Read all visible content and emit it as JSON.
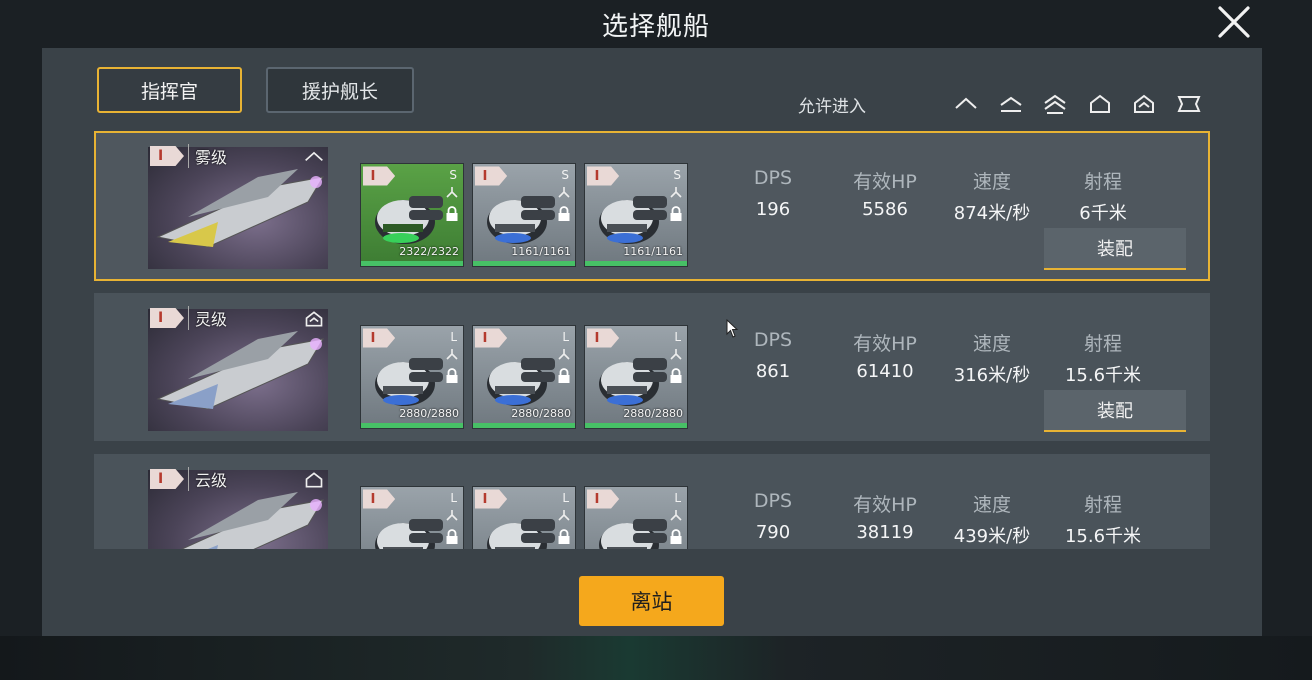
{
  "title": "选择舰船",
  "tabs": [
    {
      "label": "指挥官",
      "active": true
    },
    {
      "label": "援护舰长",
      "active": false
    }
  ],
  "filter": {
    "label": "允许进入",
    "class_icons": [
      "chevron-1-icon",
      "chevron-1-bar-icon",
      "chevron-2-icon",
      "house-icon",
      "house-chevron-icon",
      "banner-icon"
    ]
  },
  "stat_headers": {
    "dps": "DPS",
    "hp": "有效HP",
    "speed": "速度",
    "range": "射程"
  },
  "equip_label": "装配",
  "ships": [
    {
      "tier": "I",
      "name": "雾级",
      "class_icon": "chevron-1-icon",
      "selected": true,
      "weapons": [
        {
          "tier": "I",
          "size": "S",
          "hp": "2322/2322",
          "hp_fraction": 1.0,
          "highlight": true
        },
        {
          "tier": "I",
          "size": "S",
          "hp": "1161/1161",
          "hp_fraction": 1.0,
          "highlight": false
        },
        {
          "tier": "I",
          "size": "S",
          "hp": "1161/1161",
          "hp_fraction": 1.0,
          "highlight": false
        }
      ],
      "stats": {
        "dps": "196",
        "hp": "5586",
        "speed": "874米/秒",
        "range": "6千米"
      }
    },
    {
      "tier": "I",
      "name": "灵级",
      "class_icon": "house-chevron-icon",
      "selected": false,
      "weapons": [
        {
          "tier": "I",
          "size": "L",
          "hp": "2880/2880",
          "hp_fraction": 1.0,
          "highlight": false
        },
        {
          "tier": "I",
          "size": "L",
          "hp": "2880/2880",
          "hp_fraction": 1.0,
          "highlight": false
        },
        {
          "tier": "I",
          "size": "L",
          "hp": "2880/2880",
          "hp_fraction": 1.0,
          "highlight": false
        }
      ],
      "stats": {
        "dps": "861",
        "hp": "61410",
        "speed": "316米/秒",
        "range": "15.6千米"
      }
    },
    {
      "tier": "I",
      "name": "云级",
      "class_icon": "house-icon",
      "selected": false,
      "weapons": [
        {
          "tier": "I",
          "size": "L",
          "hp": "",
          "hp_fraction": 1.0,
          "highlight": false
        },
        {
          "tier": "I",
          "size": "L",
          "hp": "",
          "hp_fraction": 1.0,
          "highlight": false
        },
        {
          "tier": "I",
          "size": "L",
          "hp": "",
          "hp_fraction": 1.0,
          "highlight": false
        }
      ],
      "stats": {
        "dps": "790",
        "hp": "38119",
        "speed": "439米/秒",
        "range": "15.6千米"
      }
    }
  ],
  "depart_label": "离站",
  "colors": {
    "accent": "#e8b334",
    "depart": "#f5a81c",
    "hp_bar": "#47c166"
  }
}
